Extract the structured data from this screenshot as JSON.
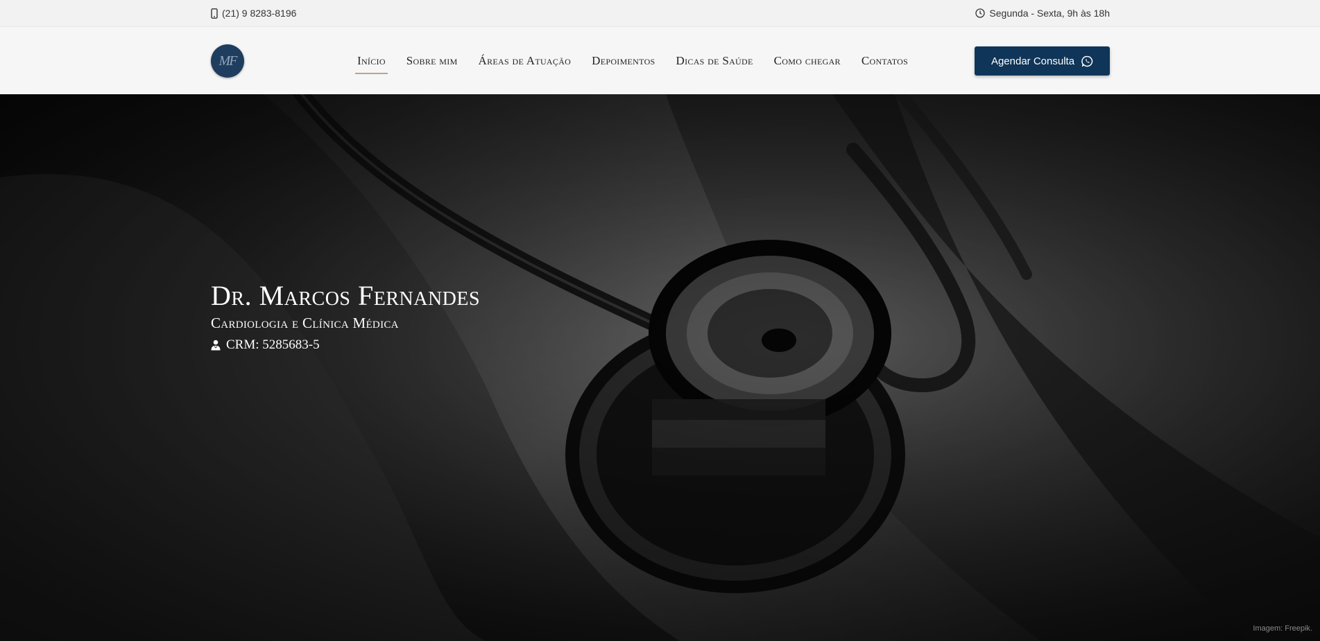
{
  "topbar": {
    "phone": "(21) 9 8283-8196",
    "hours": "Segunda - Sexta, 9h às 18h",
    "phone_icon": "mobile-phone-icon",
    "hours_icon": "clock-icon"
  },
  "logo": {
    "text": "MF"
  },
  "nav": {
    "items": [
      {
        "label": "Início",
        "active": true
      },
      {
        "label": "Sobre mim"
      },
      {
        "label": "Áreas de Atuação"
      },
      {
        "label": "Depoimentos"
      },
      {
        "label": "Dicas de Saúde"
      },
      {
        "label": "Como chegar"
      },
      {
        "label": "Contatos"
      }
    ],
    "cta_label": "Agendar Consulta",
    "cta_icon": "whatsapp-icon"
  },
  "hero": {
    "title": "Dr. Marcos Fernandes",
    "subtitle": "Cardiologia e Clínica Médica",
    "crm": "CRM: 5285683-5",
    "crm_icon": "doctor-icon",
    "credit": "Imagem: Freepik."
  },
  "colors": {
    "brand": "#0f3558",
    "accent_underline": "#b9a58f",
    "topbar_bg": "#f2f2f2"
  }
}
